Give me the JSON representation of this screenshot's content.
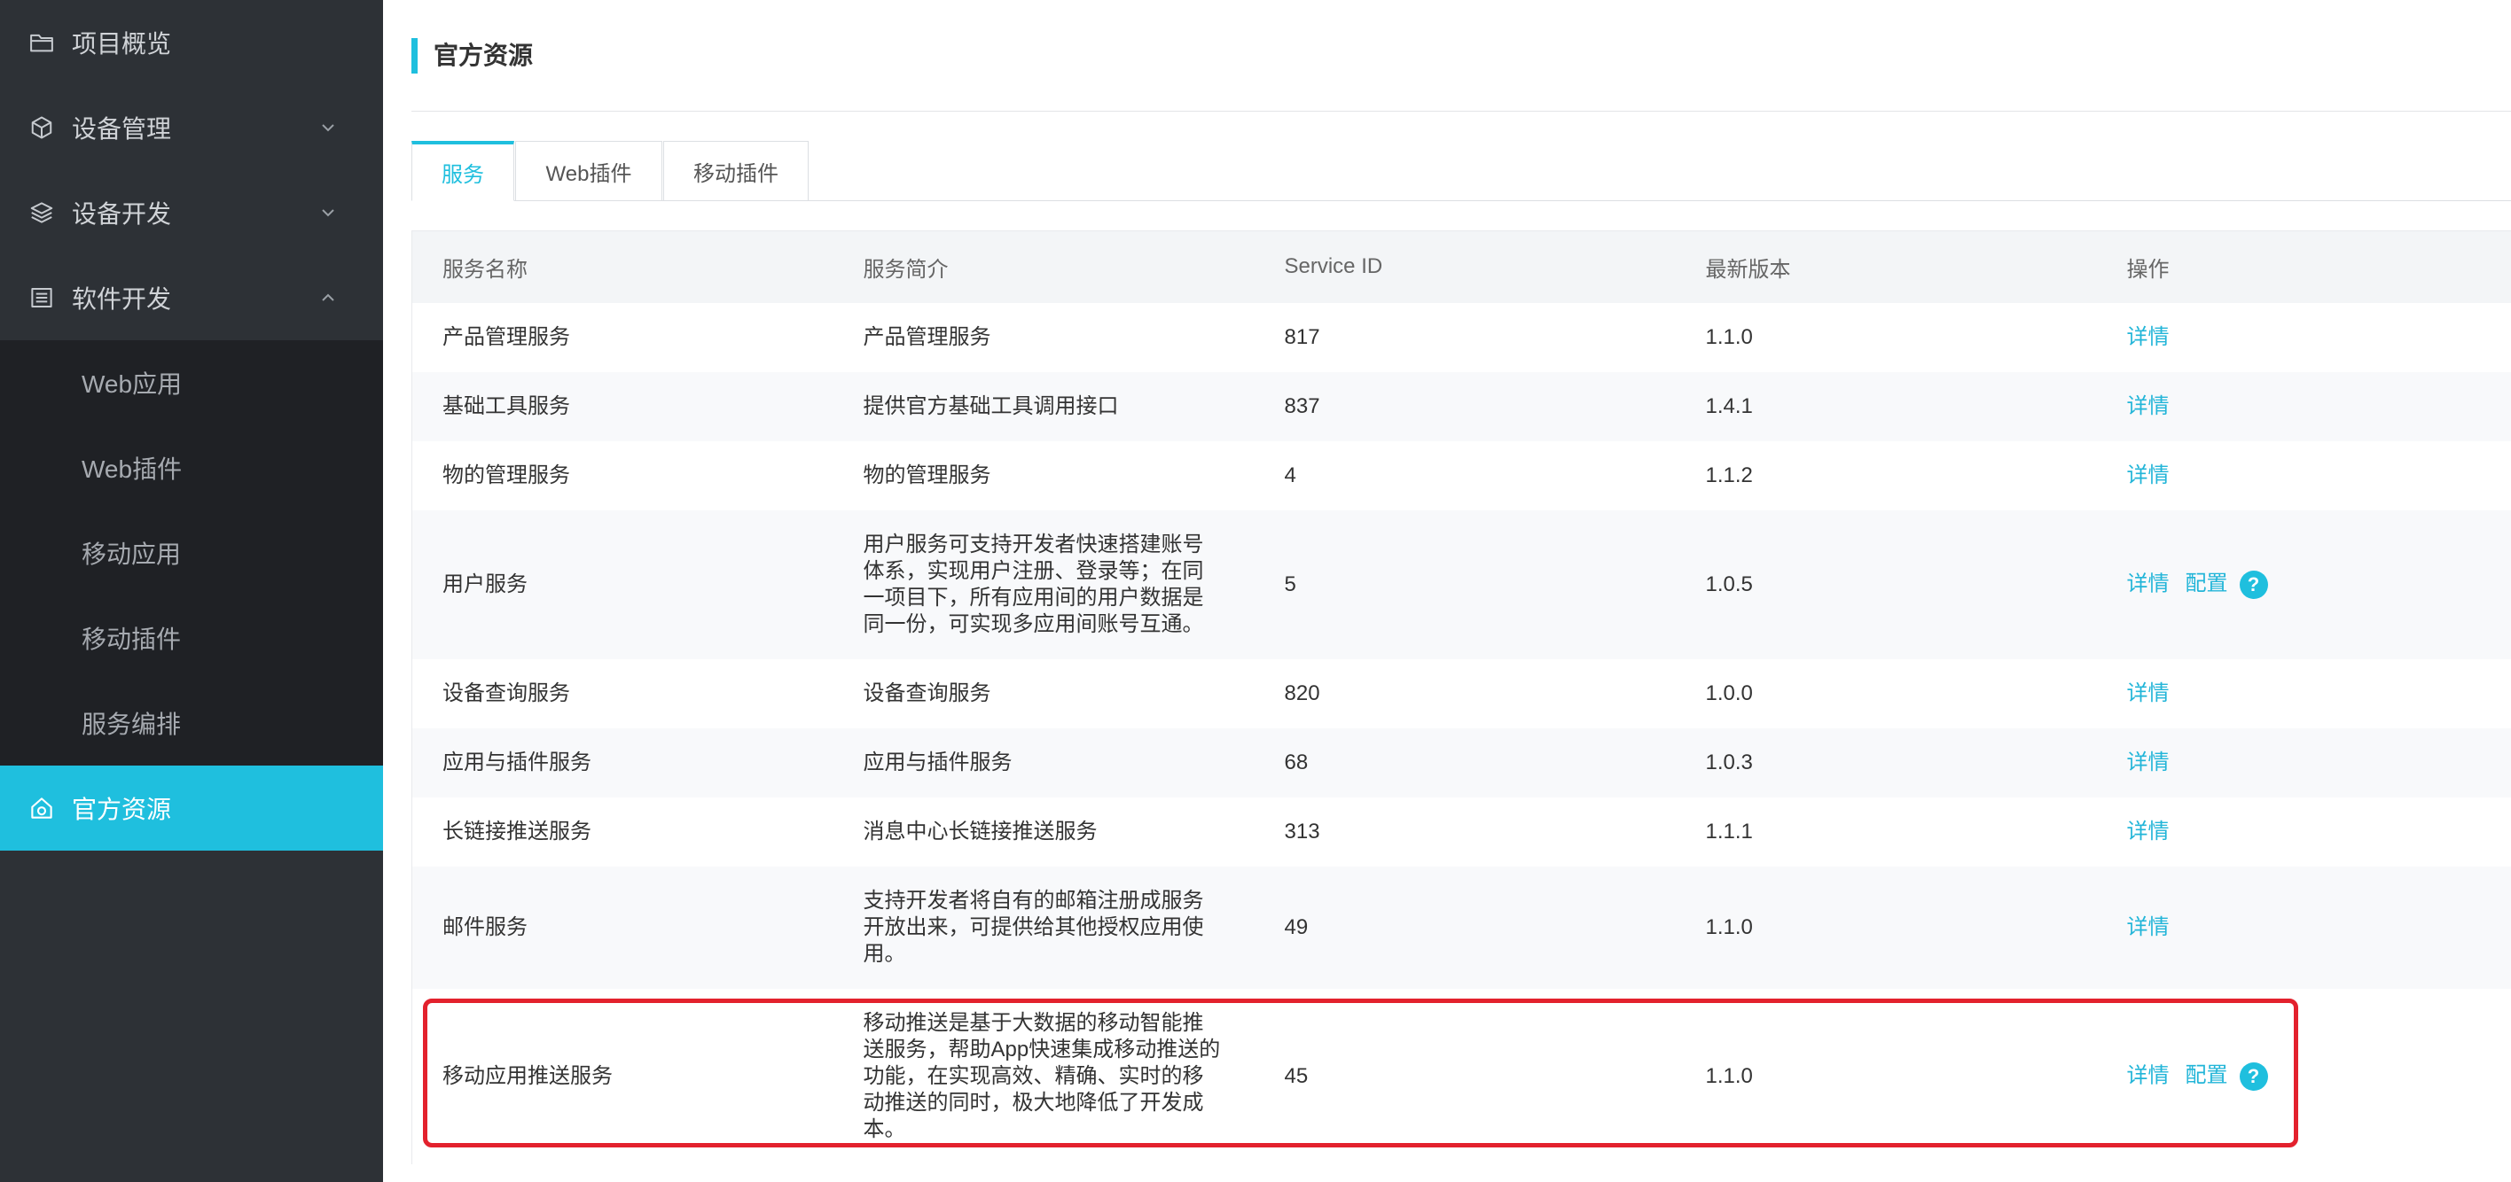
{
  "sidebar": {
    "items": [
      {
        "label": "项目概览",
        "icon": "folder-icon"
      },
      {
        "label": "设备管理",
        "icon": "cube-icon",
        "chevron": "chevron-down-icon"
      },
      {
        "label": "设备开发",
        "icon": "layers-icon",
        "chevron": "chevron-down-icon"
      },
      {
        "label": "软件开发",
        "icon": "list-icon",
        "chevron": "chevron-up-icon",
        "children": [
          {
            "label": "Web应用"
          },
          {
            "label": "Web插件"
          },
          {
            "label": "移动应用"
          },
          {
            "label": "移动插件"
          },
          {
            "label": "服务编排"
          }
        ]
      },
      {
        "label": "官方资源",
        "icon": "resource-icon",
        "active": true
      }
    ]
  },
  "page": {
    "title": "官方资源"
  },
  "tabs": [
    {
      "label": "服务",
      "active": true
    },
    {
      "label": "Web插件",
      "active": false
    },
    {
      "label": "移动插件",
      "active": false
    }
  ],
  "table": {
    "columns": [
      "服务名称",
      "服务简介",
      "Service ID",
      "最新版本",
      "操作"
    ],
    "rows": [
      {
        "name": "产品管理服务",
        "description": [
          "产品管理服务"
        ],
        "service_id": "817",
        "version": "1.1.0",
        "actions": [
          "详情"
        ]
      },
      {
        "name": "基础工具服务",
        "description": [
          "提供官方基础工具调用接口"
        ],
        "service_id": "837",
        "version": "1.4.1",
        "actions": [
          "详情"
        ]
      },
      {
        "name": "物的管理服务",
        "description": [
          "物的管理服务"
        ],
        "service_id": "4",
        "version": "1.1.2",
        "actions": [
          "详情"
        ]
      },
      {
        "name": "用户服务",
        "description": [
          "用户服务可支持开发者快速搭建账号",
          "体系，实现用户注册、登录等；在同",
          "一项目下，所有应用间的用户数据是",
          "同一份，可实现多应用间账号互通。"
        ],
        "service_id": "5",
        "version": "1.0.5",
        "actions": [
          "详情",
          "配置"
        ],
        "help": "?"
      },
      {
        "name": "设备查询服务",
        "description": [
          "设备查询服务"
        ],
        "service_id": "820",
        "version": "1.0.0",
        "actions": [
          "详情"
        ]
      },
      {
        "name": "应用与插件服务",
        "description": [
          "应用与插件服务"
        ],
        "service_id": "68",
        "version": "1.0.3",
        "actions": [
          "详情"
        ]
      },
      {
        "name": "长链接推送服务",
        "description": [
          "消息中心长链接推送服务"
        ],
        "service_id": "313",
        "version": "1.1.1",
        "actions": [
          "详情"
        ]
      },
      {
        "name": "邮件服务",
        "description": [
          "支持开发者将自有的邮箱注册成服务",
          "开放出来，可提供给其他授权应用使",
          "用。"
        ],
        "service_id": "49",
        "version": "1.1.0",
        "actions": [
          "详情"
        ]
      },
      {
        "name": "移动应用推送服务",
        "description": [
          "移动推送是基于大数据的移动智能推",
          "送服务，帮助App快速集成移动推送的",
          "功能，在实现高效、精确、实时的移",
          "动推送的同时，极大地降低了开发成",
          "本。"
        ],
        "service_id": "45",
        "version": "1.1.0",
        "actions": [
          "详情",
          "配置"
        ],
        "help": "?"
      }
    ]
  },
  "colors": {
    "accent": "#1fbfde",
    "link": "#22b5d8",
    "sidebar_bg": "#2d3136",
    "submenu_bg": "#1f2125",
    "highlight": "#e3212d"
  }
}
